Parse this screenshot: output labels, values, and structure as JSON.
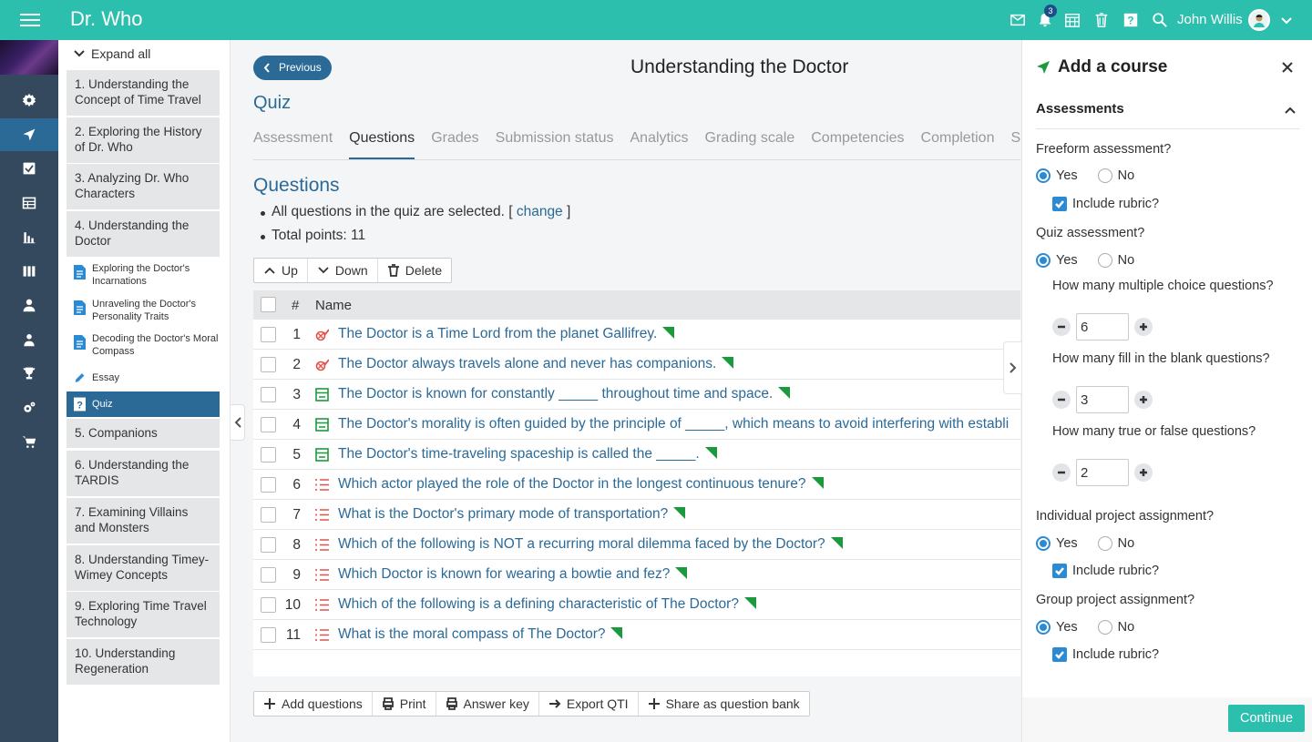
{
  "app": {
    "title": "Dr. Who",
    "notification_count": "3",
    "user_name": "John Willis"
  },
  "topbar_icons": [
    "mail-icon",
    "bell-icon",
    "calendar-icon",
    "trash-icon",
    "help-icon",
    "search-icon"
  ],
  "leftnav": [
    "gear-icon",
    "send-icon",
    "check-icon",
    "table-icon",
    "bar-chart-icon",
    "columns-icon",
    "user-icon",
    "users-icon",
    "trophy-icon",
    "cogs-icon",
    "cart-icon"
  ],
  "outline": {
    "expand_label": "Expand all",
    "units": [
      "1. Understanding the Concept of Time Travel",
      "2. Exploring the History of Dr. Who",
      "3. Analyzing Dr. Who Characters",
      "4. Understanding the Doctor",
      "5. Companions",
      "6. Understanding the TARDIS",
      "7. Examining Villains and Monsters",
      "8. Understanding Timey-Wimey Concepts",
      "9. Exploring Time Travel Technology",
      "10. Understanding Regeneration"
    ],
    "subitems": [
      "Exploring the Doctor's Incarnations",
      "Unraveling the Doctor's Personality Traits",
      "Decoding the Doctor's Moral Compass",
      "Essay",
      "Quiz"
    ]
  },
  "main": {
    "previous_label": "Previous",
    "page_title": "Understanding the Doctor",
    "section_title": "Quiz",
    "tabs": [
      "Assessment",
      "Questions",
      "Grades",
      "Submission status",
      "Analytics",
      "Grading scale",
      "Competencies",
      "Completion",
      "S"
    ],
    "questions_heading": "Questions",
    "selected_text": "All questions in the quiz are selected. [",
    "change_link": "change",
    "selected_close": "]",
    "total_points": "Total points: 11",
    "toolbar": {
      "up": "Up",
      "down": "Down",
      "delete": "Delete"
    },
    "table_header": {
      "num": "#",
      "name": "Name"
    },
    "questions": [
      {
        "num": "1",
        "type": "true-false",
        "text": "The Doctor is a Time Lord from the planet Gallifrey."
      },
      {
        "num": "2",
        "type": "true-false",
        "text": "The Doctor always travels alone and never has companions."
      },
      {
        "num": "3",
        "type": "fill-blank",
        "text": "The Doctor is known for constantly _____ throughout time and space."
      },
      {
        "num": "4",
        "type": "fill-blank",
        "text": "The Doctor's morality is often guided by the principle of _____, which means to avoid interfering with establi"
      },
      {
        "num": "5",
        "type": "fill-blank",
        "text": "The Doctor's time-traveling spaceship is called the _____."
      },
      {
        "num": "6",
        "type": "multiple-choice",
        "text": "Which actor played the role of the Doctor in the longest continuous tenure?"
      },
      {
        "num": "7",
        "type": "multiple-choice",
        "text": "What is the Doctor's primary mode of transportation?"
      },
      {
        "num": "8",
        "type": "multiple-choice",
        "text": "Which of the following is NOT a recurring moral dilemma faced by the Doctor?"
      },
      {
        "num": "9",
        "type": "multiple-choice",
        "text": "Which Doctor is known for wearing a bowtie and fez?"
      },
      {
        "num": "10",
        "type": "multiple-choice",
        "text": "Which of the following is a defining characteristic of The Doctor?"
      },
      {
        "num": "11",
        "type": "multiple-choice",
        "text": "What is the moral compass of The Doctor?"
      }
    ],
    "bottom_toolbar": {
      "add": "Add questions",
      "print": "Print",
      "answer_key": "Answer key",
      "export": "Export QTI",
      "share": "Share as question bank"
    }
  },
  "panel": {
    "title": "Add a course",
    "section": "Assessments",
    "freeform_label": "Freeform assessment?",
    "quiz_label": "Quiz assessment?",
    "individual_label": "Individual project assignment?",
    "group_label": "Group project assignment?",
    "yes": "Yes",
    "no": "No",
    "include_rubric": "Include rubric?",
    "mc_label": "How many multiple choice questions?",
    "mc_value": "6",
    "fib_label": "How many fill in the blank questions?",
    "fib_value": "3",
    "tf_label": "How many true or false questions?",
    "tf_value": "2",
    "continue_label": "Continue"
  },
  "colors": {
    "topbar": "#2dbfad",
    "nav": "#34495e",
    "accent": "#2b6a97",
    "link": "#2b6a97",
    "flag": "#1a9a3c",
    "radio": "#2b8ad4"
  }
}
